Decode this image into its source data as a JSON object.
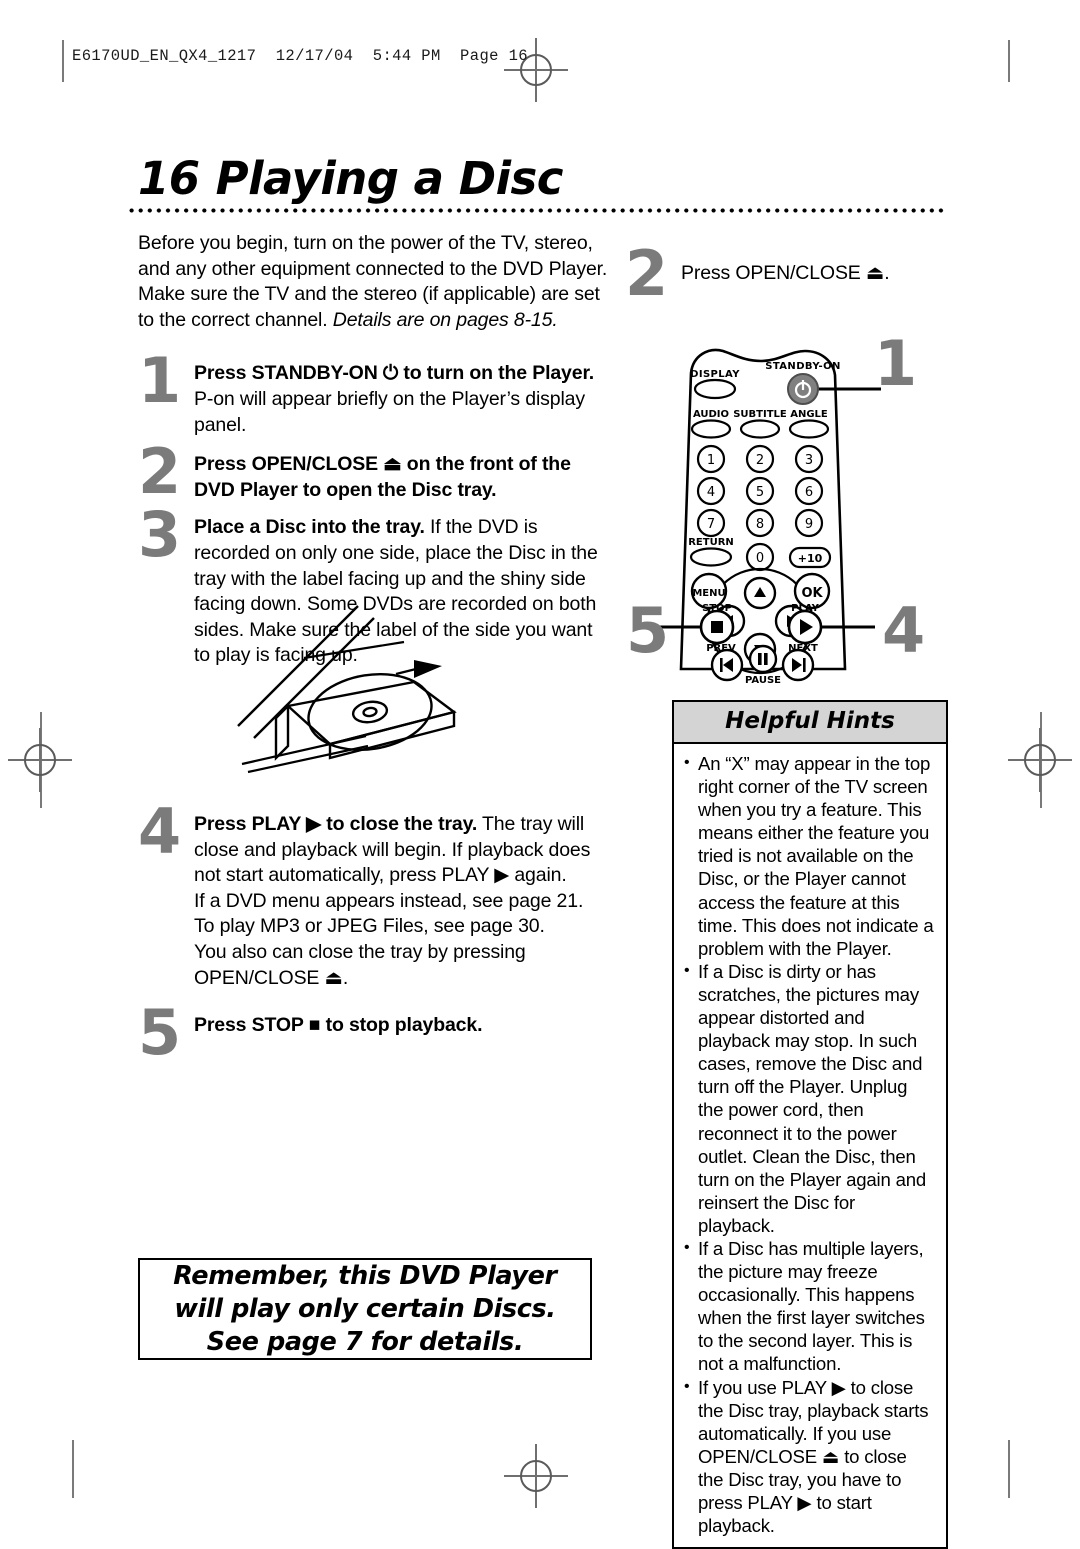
{
  "print_slug": "E6170UD_EN_QX4_1217  12/17/04  5:44 PM  Page 16",
  "page": {
    "number": "16",
    "title": "Playing a Disc"
  },
  "intro": {
    "text": "Before you begin, turn on the power of the TV, stereo, and any other equipment connected to the DVD Player. Make sure the TV and the stereo (if applicable) are set to the correct channel. ",
    "italic_tail": "Details are on pages 8-15."
  },
  "steps": [
    {
      "number": "1",
      "bold": "Press STANDBY-ON ⏻ to turn on the Player.",
      "rest": "P-on will appear briefly on the Player’s display panel."
    },
    {
      "number": "2",
      "bold": "Press OPEN/CLOSE ⏏ on the front of the DVD Player to open the Disc tray.",
      "rest": ""
    },
    {
      "number": "3",
      "bold": "Place a Disc into the tray.",
      "rest": " If the DVD is recorded on only one side, place the Disc in the tray with the label facing up and the shiny side facing down. Some DVDs are recorded on both sides. Make sure the label of the side you want to play is facing up."
    },
    {
      "number": "4",
      "bold": "Press PLAY ▶ to close the tray.",
      "rest": " The tray will close and playback will begin. If playback does not start automatically, press PLAY ▶ again.\nIf a DVD menu appears instead, see page 21.\nTo play MP3 or JPEG Files, see page 30.\nYou also can close the tray by pressing\nOPEN/CLOSE ⏏."
    },
    {
      "number": "5",
      "bold": "Press STOP ■ to stop playback.",
      "rest": ""
    }
  ],
  "right_step": {
    "number": "2",
    "text": "Press OPEN/CLOSE ⏏."
  },
  "remember_box": {
    "line1": "Remember, this DVD Player",
    "line2": "will play only certain Discs.",
    "line3": "See page 7 for details."
  },
  "remote": {
    "callouts": [
      {
        "number": "1",
        "target": "standby-on"
      },
      {
        "number": "4",
        "target": "play"
      },
      {
        "number": "5",
        "target": "stop"
      }
    ],
    "buttons": [
      {
        "label": "DISPLAY",
        "shape": "oval"
      },
      {
        "label": "STANDBY-ON",
        "shape": "circle-gray",
        "glyph": "⏻"
      },
      {
        "label": "AUDIO",
        "shape": "oval"
      },
      {
        "label": "SUBTITLE",
        "shape": "oval"
      },
      {
        "label": "ANGLE",
        "shape": "oval"
      },
      {
        "label": "1",
        "shape": "circle"
      },
      {
        "label": "2",
        "shape": "circle"
      },
      {
        "label": "3",
        "shape": "circle"
      },
      {
        "label": "4",
        "shape": "circle"
      },
      {
        "label": "5",
        "shape": "circle"
      },
      {
        "label": "6",
        "shape": "circle"
      },
      {
        "label": "7",
        "shape": "circle"
      },
      {
        "label": "8",
        "shape": "circle"
      },
      {
        "label": "9",
        "shape": "circle"
      },
      {
        "label": "RETURN",
        "shape": "oval"
      },
      {
        "label": "0",
        "shape": "circle"
      },
      {
        "label": "+10",
        "shape": "pill"
      },
      {
        "label": "MENU",
        "shape": "circle"
      },
      {
        "label": "OK",
        "shape": "circle"
      },
      {
        "label": "STOP",
        "shape": "circle",
        "glyph": "■"
      },
      {
        "label": "PLAY",
        "shape": "circle",
        "glyph": "▶"
      },
      {
        "label": "PREV",
        "shape": "circle",
        "glyph": "⏮"
      },
      {
        "label": "PAUSE",
        "shape": "circle",
        "glyph": "⏸"
      },
      {
        "label": "NEXT",
        "shape": "circle",
        "glyph": "⏭"
      }
    ],
    "labels": {
      "display": "DISPLAY",
      "standby": "STANDBY-ON",
      "audio": "AUDIO",
      "subtitle": "SUBTITLE",
      "angle": "ANGLE",
      "return": "RETURN",
      "plus10": "+10",
      "menu": "MENU",
      "ok": "OK",
      "stop": "STOP",
      "play": "PLAY",
      "prev": "PREV",
      "pause": "PAUSE",
      "next": "NEXT",
      "k1": "1",
      "k2": "2",
      "k3": "3",
      "k4": "4",
      "k5": "5",
      "k6": "6",
      "k7": "7",
      "k8": "8",
      "k9": "9",
      "k0": "0"
    }
  },
  "helpful_hints": {
    "header": "Helpful Hints",
    "items": [
      "An “X” may appear in the top right corner of the TV screen when you try a feature. This means either the feature you tried is not available on the Disc, or the Player cannot access the feature at this time. This does not indicate a problem with the Player.",
      "If a Disc is dirty or has scratches, the pictures may appear distorted and playback may stop. In such cases, remove the Disc and turn off the Player. Unplug the power cord, then reconnect it to the power outlet. Clean the Disc, then turn on the Player again and reinsert the Disc for playback.",
      "If a Disc has multiple layers, the picture may freeze occasionally. This happens when the first layer switches to the second layer. This is not a malfunction.",
      "If you use PLAY ▶ to close the Disc tray, playback starts automatically. If you use OPEN/CLOSE ⏏ to close the Disc tray, you have to press PLAY ▶ to start playback."
    ]
  },
  "colors": {
    "step_number": "#7b7b7b",
    "hints_header_bg": "#d4d4d4",
    "registration_mark": "#6f6f6f"
  }
}
